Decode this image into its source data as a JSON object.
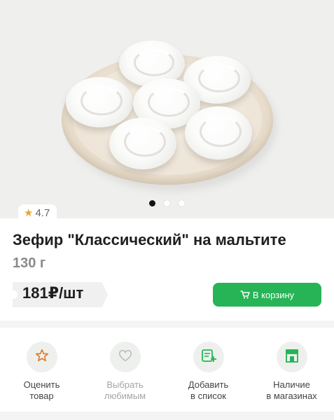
{
  "product": {
    "rating": "4.7",
    "title": "Зефир \"Классический\" на мальтите",
    "weight": "130 г",
    "price": "181₽/шт",
    "cart_button_label": "В корзину",
    "gallery": {
      "slide_count": 3,
      "active_slide": 1
    }
  },
  "actions": [
    {
      "label_line1": "Оценить",
      "label_line2": "товар",
      "icon": "star-outline-icon"
    },
    {
      "label_line1": "Выбрать",
      "label_line2": "любимым",
      "icon": "heart-outline-icon"
    },
    {
      "label_line1": "Добавить",
      "label_line2": "в список",
      "icon": "add-to-list-icon"
    },
    {
      "label_line1": "Наличие",
      "label_line2": "в магазинах",
      "icon": "store-icon"
    }
  ],
  "colors": {
    "accent": "#27b457",
    "star": "#e8a33d",
    "muted_text": "#8a8a8a"
  }
}
